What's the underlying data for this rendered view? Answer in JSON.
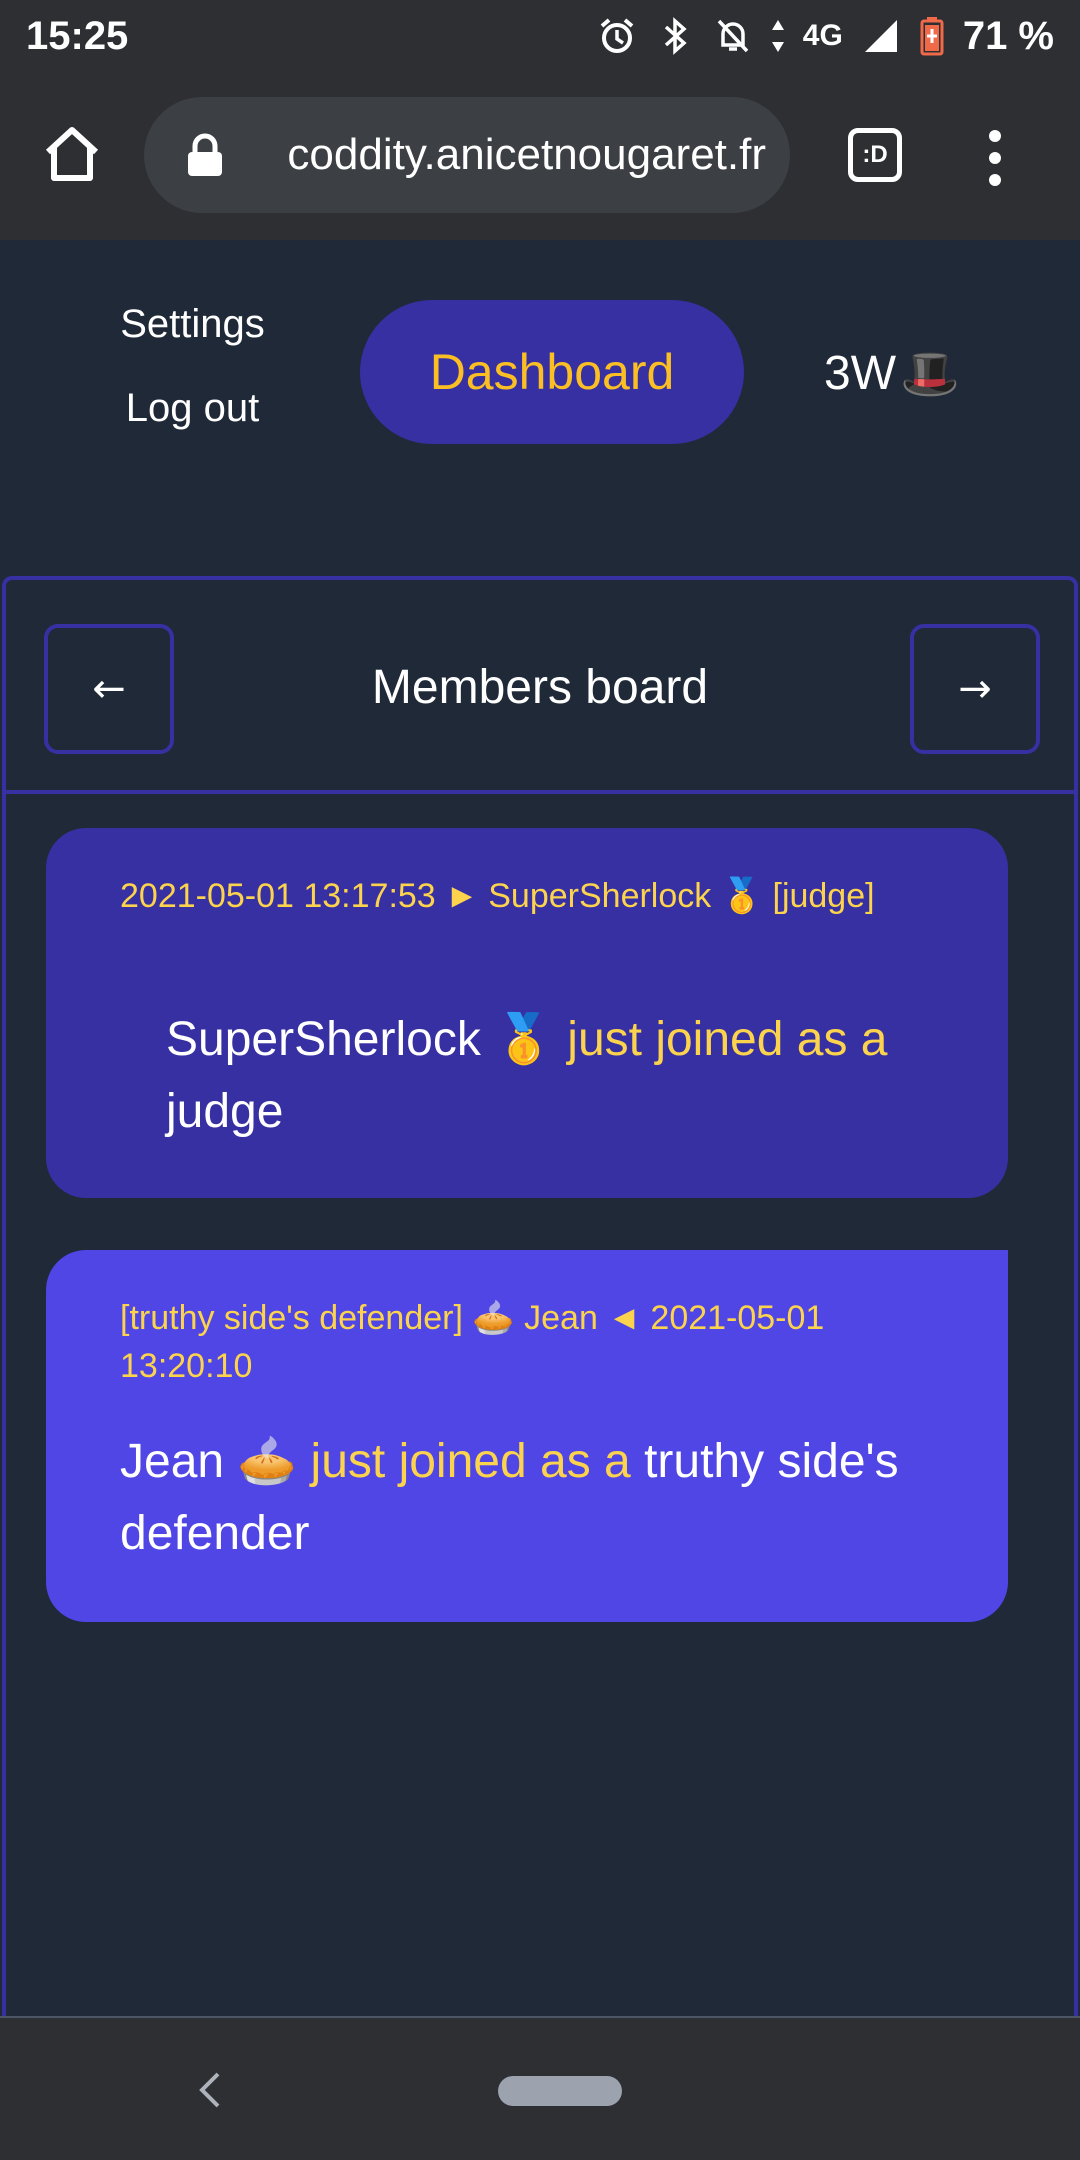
{
  "status_bar": {
    "time": "15:25",
    "network": "4G",
    "battery": "71 %",
    "icons": [
      "alarm-icon",
      "bluetooth-icon",
      "mute-icon",
      "data-arrows-icon",
      "signal-icon",
      "battery-icon"
    ]
  },
  "browser": {
    "url": "coddity.anicetnougaret.fr",
    "tab_button_label": ":D",
    "icons": [
      "home-icon",
      "lock-icon",
      "menu-dots-icon"
    ]
  },
  "header": {
    "settings_label": "Settings",
    "logout_label": "Log out",
    "dashboard_label": "Dashboard",
    "brand_text": "3W",
    "brand_emoji": "🎩"
  },
  "board": {
    "title": "Members board",
    "prev_label": "←",
    "next_label": "→",
    "messages": [
      {
        "meta_line": "2021-05-01 13:17:53 ► SuperSherlock 🥇 [judge]",
        "name": "SuperSherlock 🥇",
        "action": "just joined as a",
        "role": "judge"
      },
      {
        "meta_line": "[truthy side's defender] 🥧 Jean ◄ 2021-05-01 13:20:10",
        "name": "Jean 🥧",
        "action": "just joined as a",
        "role": "truthy side's defender"
      }
    ]
  },
  "colors": {
    "page_bg": "#1f2937",
    "accent": "#3730a3",
    "accent_light": "#4f46e5",
    "highlight": "#fcd34d",
    "system_bar": "#2d2f33"
  }
}
